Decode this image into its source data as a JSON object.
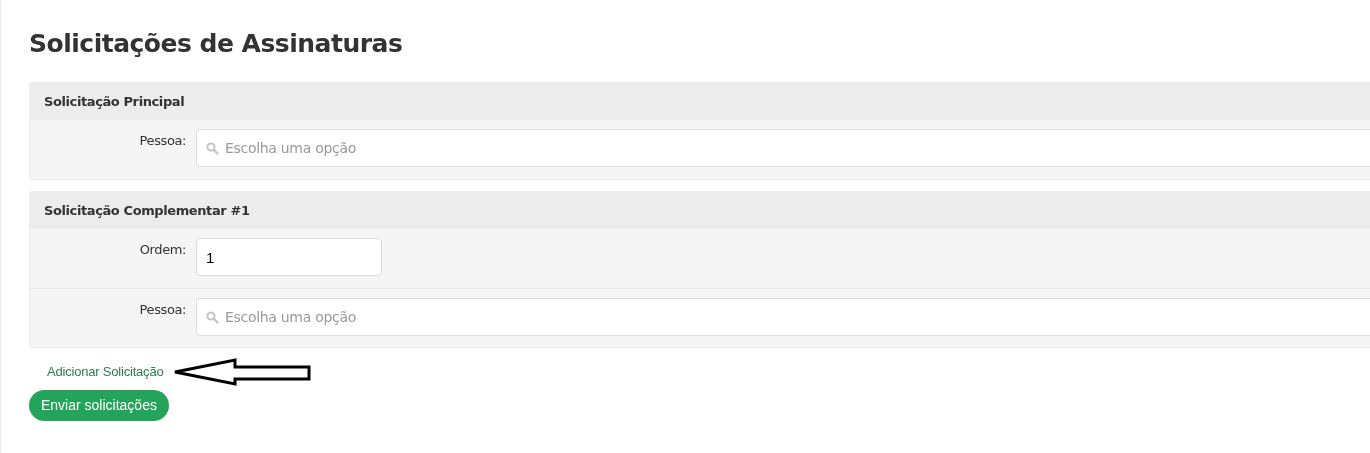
{
  "title": "Solicitações de Assinaturas",
  "sections": [
    {
      "header": "Solicitação Principal",
      "fields": [
        {
          "kind": "select",
          "label": "Pessoa:",
          "placeholder": "Escolha uma opção"
        }
      ]
    },
    {
      "header": "Solicitação Complementar #1",
      "fields": [
        {
          "kind": "text",
          "label": "Ordem:",
          "value": "1"
        },
        {
          "kind": "select",
          "label": "Pessoa:",
          "placeholder": "Escolha uma opção"
        }
      ]
    }
  ],
  "add_link": "Adicionar Solicitação",
  "submit_button": "Enviar solicitações"
}
